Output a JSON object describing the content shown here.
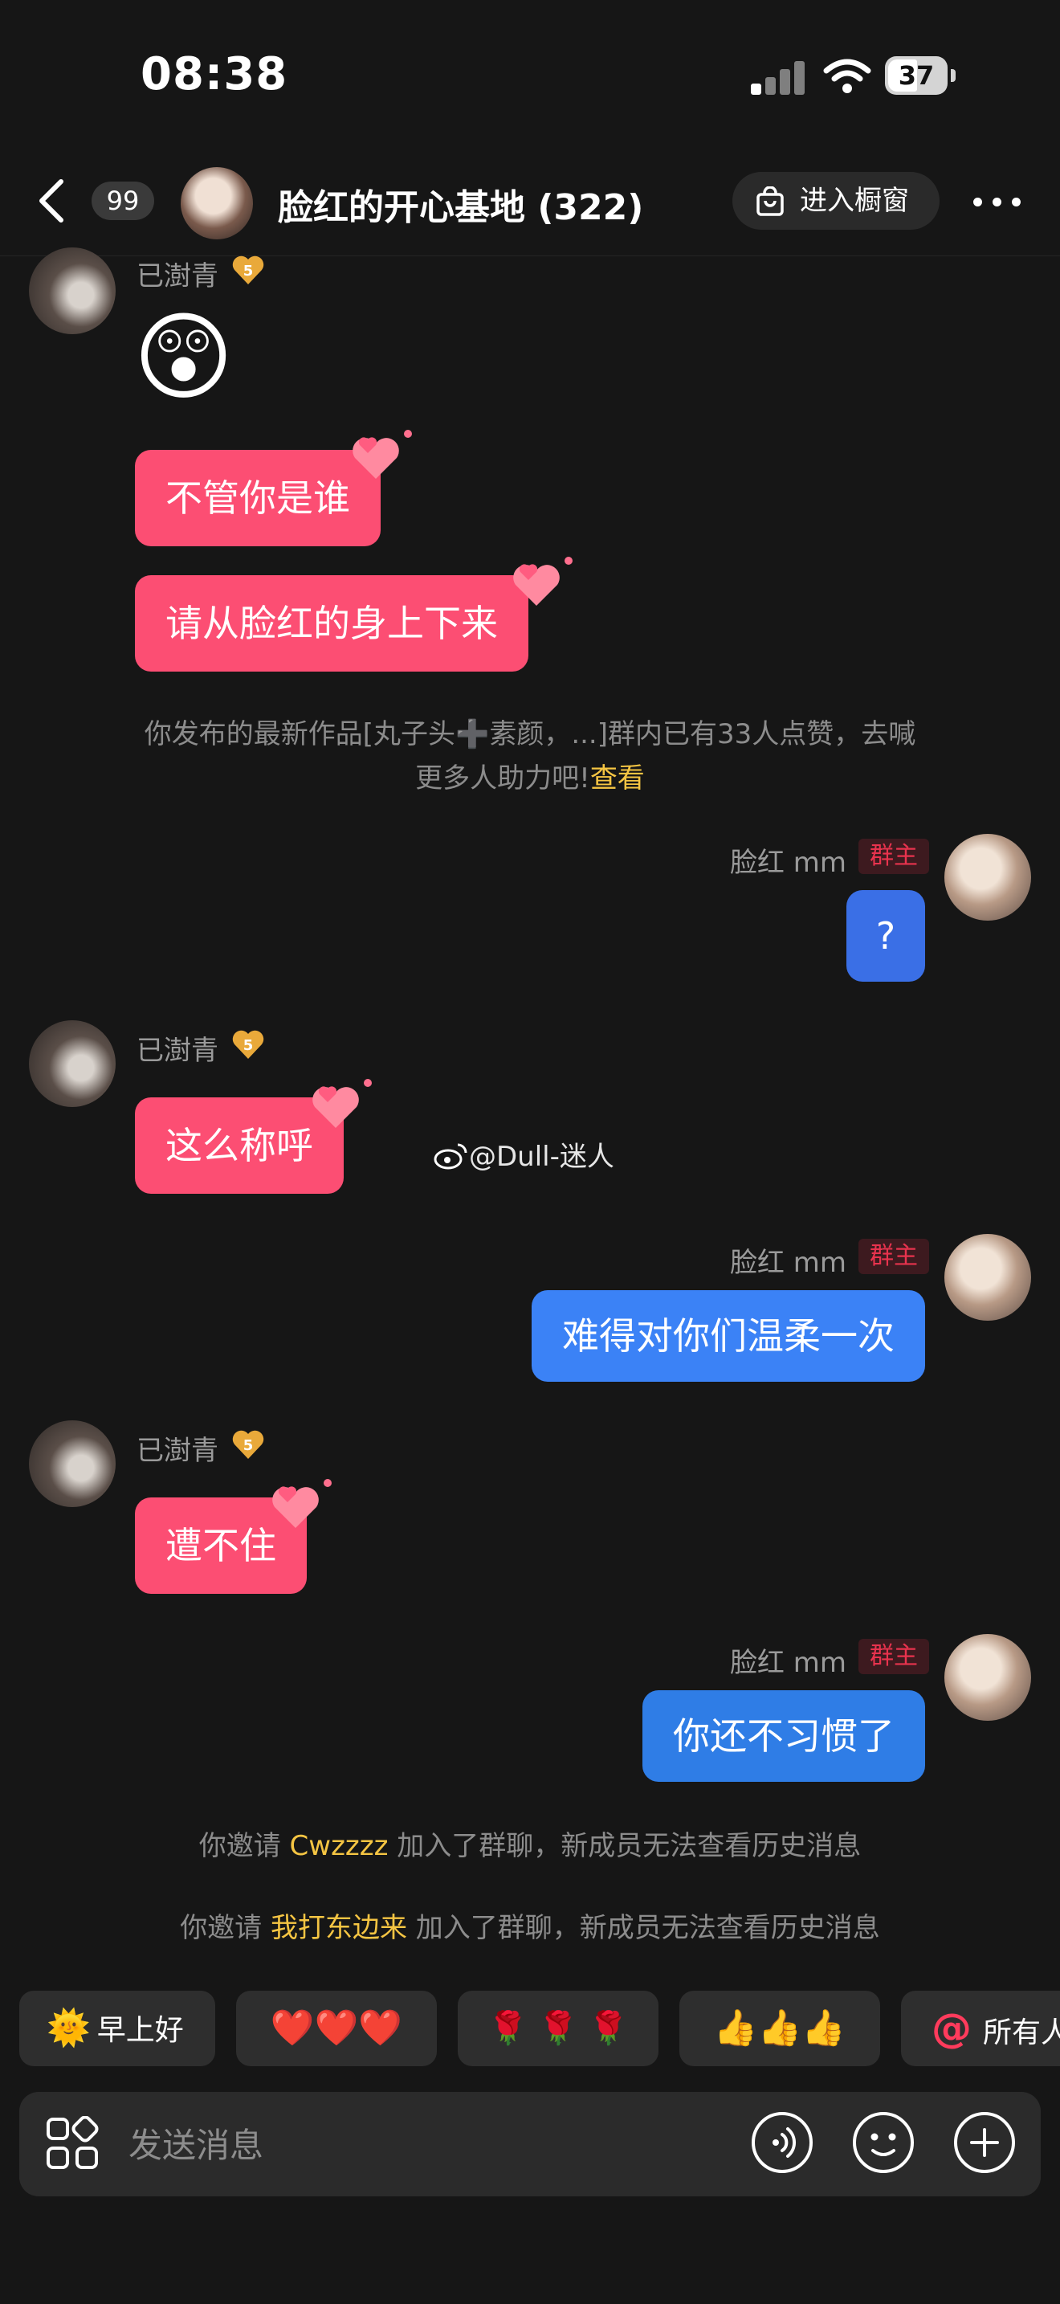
{
  "status_bar": {
    "time": "08:38",
    "battery": "37"
  },
  "header": {
    "unread_count": "99",
    "title": "脸红的开心基地 (322)",
    "shop_label": "进入橱窗"
  },
  "messages": [
    {
      "sender": "已澍青",
      "level": "5",
      "type": "emoji",
      "content": "😲"
    },
    {
      "sender": "已澍青",
      "type": "text",
      "content": "不管你是谁"
    },
    {
      "sender": "已澍青",
      "type": "text",
      "content": "请从脸红的身上下来"
    },
    {
      "type": "system",
      "line1": "你发布的最新作品[丸子头➕素颜，...]群内已有33人点赞，去喊",
      "line2": "更多人助力吧!",
      "link": "查看"
    },
    {
      "sender": "脸红 mm",
      "tag": "群主",
      "type": "text",
      "content": "?"
    },
    {
      "sender": "已澍青",
      "level": "5",
      "type": "text",
      "content": "这么称呼"
    },
    {
      "sender": "脸红 mm",
      "tag": "群主",
      "type": "text",
      "content": "难得对你们温柔一次"
    },
    {
      "sender": "已澍青",
      "level": "5",
      "type": "text",
      "content": "遭不住"
    },
    {
      "sender": "脸红 mm",
      "tag": "群主",
      "type": "text",
      "content": "你还不习惯了"
    },
    {
      "type": "system",
      "prefix": "你邀请 ",
      "name": "Cwzzzz",
      "suffix": " 加入了群聊，新成员无法查看历史消息"
    },
    {
      "type": "system",
      "prefix": "你邀请 ",
      "name": "我打东边来",
      "suffix": " 加入了群聊，新成员无法查看历史消息"
    }
  ],
  "watermark": "@Dull-迷人",
  "quick_replies": [
    {
      "label": "早上好",
      "emoji": "🌞"
    },
    {
      "label": "",
      "emoji": "❤️❤️❤️"
    },
    {
      "label": "",
      "emoji": "🌹 🌹 🌹"
    },
    {
      "label": "",
      "emoji": "👍👍👍"
    },
    {
      "label": "所有人",
      "emoji": "@"
    }
  ],
  "input": {
    "placeholder": "发送消息"
  },
  "colors": {
    "pink_bubble": "#fc4e73",
    "blue_bubble": "#3b82f6",
    "highlight": "#f5c543",
    "owner_tag": "#e8334e"
  },
  "icons": [
    "back-icon",
    "bag-icon",
    "more-icon",
    "apps-icon",
    "voice-icon",
    "emoji-icon",
    "plus-icon",
    "level-heart-icon",
    "weibo-icon"
  ]
}
